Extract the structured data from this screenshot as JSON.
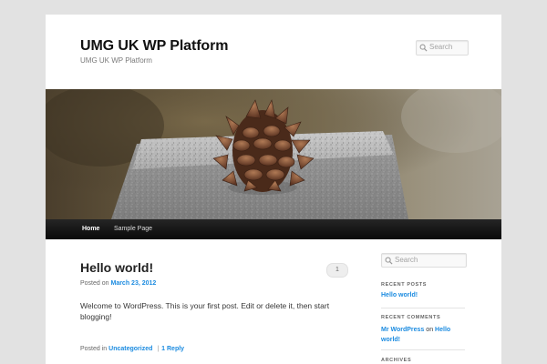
{
  "site": {
    "title": "UMG UK WP Platform",
    "description": "UMG UK WP Platform"
  },
  "header_search": {
    "placeholder": "Search",
    "icon": "search-icon"
  },
  "nav": {
    "items": [
      {
        "label": "Home",
        "active": true
      },
      {
        "label": "Sample Page",
        "active": false
      }
    ]
  },
  "post": {
    "title": "Hello world!",
    "comment_count": "1",
    "posted_on_label": "Posted on",
    "date": "March 23, 2012",
    "content": "Welcome to WordPress. This is your first post. Edit or delete it, then start blogging!",
    "posted_in_label": "Posted in",
    "category": "Uncategorized",
    "separator": "|",
    "reply_link": "1 Reply"
  },
  "sidebar": {
    "search_placeholder": "Search",
    "recent_posts": {
      "title": "RECENT POSTS",
      "items": [
        "Hello world!"
      ]
    },
    "recent_comments": {
      "title": "RECENT COMMENTS",
      "author": "Mr WordPress",
      "on_word": "on",
      "post": "Hello world!"
    },
    "archives": {
      "title": "ARCHIVES"
    }
  },
  "colors": {
    "page_bg": "#e2e2e2",
    "content_bg": "#ffffff",
    "link": "#1b8be0",
    "nav_bg": "#1a1a1a",
    "text": "#373737"
  }
}
